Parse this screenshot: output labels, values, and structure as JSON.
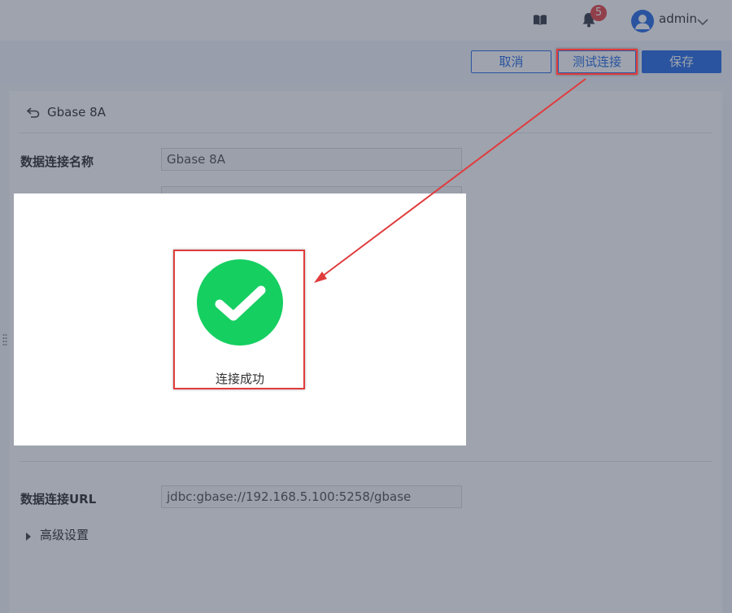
{
  "header": {
    "notification_count": "5",
    "username": "admin"
  },
  "toolbar": {
    "cancel_label": "取消",
    "test_label": "测试连接",
    "save_label": "保存"
  },
  "form": {
    "back_title": "Gbase 8A",
    "name_label": "数据连接名称",
    "name_value": "Gbase 8A",
    "url_label": "数据连接URL",
    "url_value": "jdbc:gbase://192.168.5.100:5258/gbase",
    "advanced_label": "高级设置"
  },
  "dialog": {
    "message": "连接成功"
  },
  "colors": {
    "primary": "#2c6fe3",
    "success": "#15cf61",
    "annotation": "#e03c3c",
    "badge": "#e84a4a"
  }
}
